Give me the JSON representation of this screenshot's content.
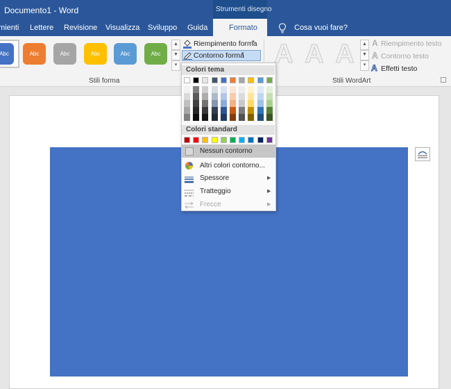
{
  "titlebar": {
    "title": "Documento1  -  Word",
    "context_group": "Strumenti disegno"
  },
  "tabs": [
    {
      "label": "mienti"
    },
    {
      "label": "Lettere"
    },
    {
      "label": "Revisione"
    },
    {
      "label": "Visualizza"
    },
    {
      "label": "Sviluppo"
    },
    {
      "label": "Guida"
    }
  ],
  "active_tab": "Formato",
  "tell_me": "Cosa vuoi fare?",
  "ribbon": {
    "shape_style_swatches": [
      {
        "label": "Abc",
        "color": "#4472c4"
      },
      {
        "label": "Abc",
        "color": "#ed7d31"
      },
      {
        "label": "Abc",
        "color": "#a5a5a5"
      },
      {
        "label": "Abc",
        "color": "#ffc000"
      },
      {
        "label": "Abc",
        "color": "#5b9bd5"
      },
      {
        "label": "Abc",
        "color": "#70ad47"
      }
    ],
    "fill_cmd": "Riempimento forma",
    "outline_cmd": "Contorno forma",
    "group_shape_styles": "Stili forma",
    "wordart_glyph": "A",
    "text_fill": "Riempimento testo",
    "text_outline": "Contorno testo",
    "text_effects": "Effetti testo",
    "group_wordart": "Stili WordArt"
  },
  "menu": {
    "theme_header": "Colori tema",
    "theme_top": [
      "#ffffff",
      "#000000",
      "#e7e6e6",
      "#44546a",
      "#4472c4",
      "#ed7d31",
      "#a5a5a5",
      "#ffc000",
      "#5b9bd5",
      "#70ad47"
    ],
    "theme_shades": [
      [
        "#f2f2f2",
        "#d9d9d9",
        "#bfbfbf",
        "#a6a6a6",
        "#808080"
      ],
      [
        "#808080",
        "#595959",
        "#404040",
        "#262626",
        "#0d0d0d"
      ],
      [
        "#d0cece",
        "#aeabab",
        "#757171",
        "#3a3838",
        "#171616"
      ],
      [
        "#d6dce4",
        "#adb9ca",
        "#8496b0",
        "#333f4f",
        "#222a35"
      ],
      [
        "#d9e2f3",
        "#b4c6e7",
        "#8eaadb",
        "#2f5496",
        "#1f3864"
      ],
      [
        "#fbe5d5",
        "#f7cbac",
        "#f4b183",
        "#c55a11",
        "#833c0b"
      ],
      [
        "#ededed",
        "#dbdbdb",
        "#c9c9c9",
        "#7b7b7b",
        "#525252"
      ],
      [
        "#fff2cc",
        "#fee599",
        "#ffd965",
        "#bf9000",
        "#7f6000"
      ],
      [
        "#deebf6",
        "#bdd7ee",
        "#9dc3e6",
        "#2e75b5",
        "#1e4e79"
      ],
      [
        "#e2efd9",
        "#c5e0b3",
        "#a8d08d",
        "#538135",
        "#375623"
      ]
    ],
    "standard_header": "Colori standard",
    "standard_colors": [
      "#c00000",
      "#ff0000",
      "#ffc000",
      "#ffff00",
      "#92d050",
      "#00b050",
      "#00b0f0",
      "#0070c0",
      "#002060",
      "#7030a0"
    ],
    "no_outline": "Nessun contorno",
    "more_colors": "Altri colori contorno...",
    "weight": "Spessore",
    "dashes": "Tratteggio",
    "arrows": "Frecce"
  },
  "shape": {
    "fill": "#4472c4"
  }
}
